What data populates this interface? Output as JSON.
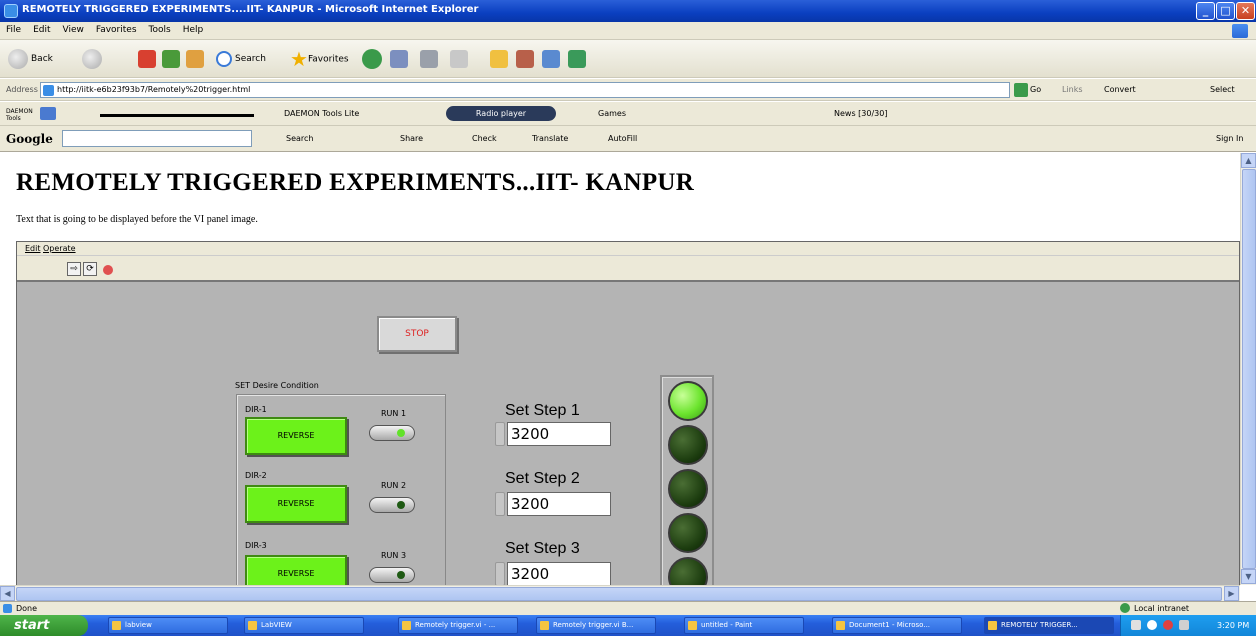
{
  "window": {
    "title": "REMOTELY TRIGGERED EXPERIMENTS....IIT- KANPUR - Microsoft Internet Explorer",
    "min": "_",
    "max": "□",
    "close": "✕"
  },
  "menu": [
    "File",
    "Edit",
    "View",
    "Favorites",
    "Tools",
    "Help"
  ],
  "toolbar": {
    "back": "Back",
    "search": "Search",
    "favorites": "Favorites"
  },
  "address": {
    "label": "Address",
    "url": "http://iitk-e6b23f93b7/Remotely%20trigger.html",
    "go": "Go",
    "links": "Links",
    "convert": "Convert",
    "select": "Select"
  },
  "daemonbar": {
    "daemon": "DAEMON Tools",
    "daemon_lite": "DAEMON Tools Lite",
    "radio": "Radio player",
    "games": "Games",
    "news": "News [30/30]"
  },
  "googlebar": {
    "logo": "Google",
    "search": "Search",
    "share": "Share",
    "check": "Check",
    "translate": "Translate",
    "autofill": "AutoFill",
    "signin": "Sign In"
  },
  "page": {
    "heading": "REMOTELY TRIGGERED EXPERIMENTS...IIT- KANPUR",
    "intro": "Text that is going to be displayed before the VI panel image."
  },
  "vi": {
    "menu_edit": "Edit",
    "menu_operate": "Operate",
    "stop": "STOP",
    "condition_label": "SET Desire Condition",
    "dirs": [
      {
        "label": "DIR-1",
        "button": "REVERSE",
        "run": "RUN 1",
        "run_on": true
      },
      {
        "label": "DIR-2",
        "button": "REVERSE",
        "run": "RUN 2",
        "run_on": false
      },
      {
        "label": "DIR-3",
        "button": "REVERSE",
        "run": "RUN 3",
        "run_on": false
      }
    ],
    "steps": [
      {
        "label": "Set Step 1",
        "value": "3200"
      },
      {
        "label": "Set Step 2",
        "value": "3200"
      },
      {
        "label": "Set Step 3",
        "value": "3200"
      }
    ],
    "leds": [
      true,
      false,
      false,
      false,
      false
    ]
  },
  "status": {
    "left": "Done",
    "right": "Local intranet"
  },
  "taskbar": {
    "start": "start",
    "tasks": [
      "labview",
      "LabVIEW",
      "Remotely trigger.vi - ...",
      "Remotely trigger.vi B...",
      "untitled - Paint",
      "Document1 - Microso...",
      "REMOTELY TRIGGER..."
    ],
    "clock": "3:20 PM"
  }
}
